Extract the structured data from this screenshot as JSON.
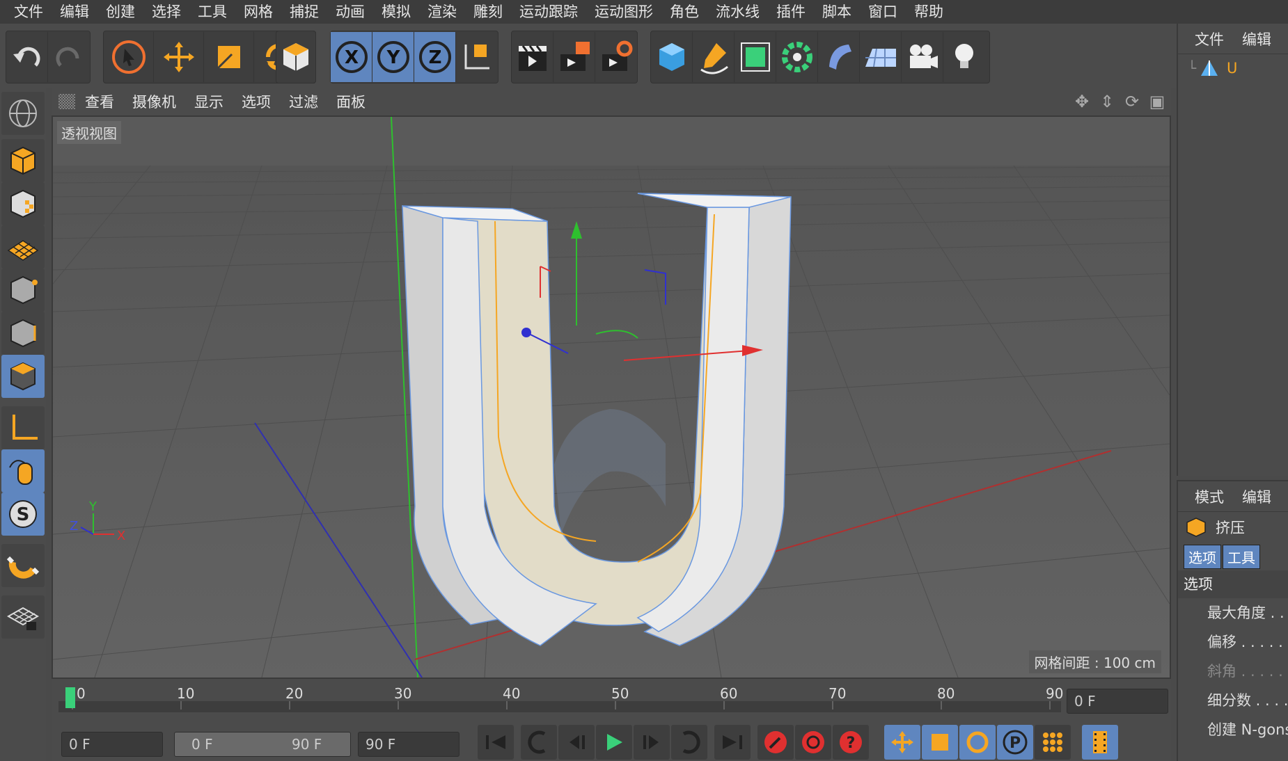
{
  "menu": [
    "文件",
    "编辑",
    "创建",
    "选择",
    "工具",
    "网格",
    "捕捉",
    "动画",
    "模拟",
    "渲染",
    "雕刻",
    "运动跟踪",
    "运动图形",
    "角色",
    "流水线",
    "插件",
    "脚本",
    "窗口",
    "帮助"
  ],
  "axes": {
    "x": "X",
    "y": "Y",
    "z": "Z"
  },
  "viewport": {
    "menu": [
      "查看",
      "摄像机",
      "显示",
      "选项",
      "过滤",
      "面板"
    ],
    "label": "透视视图",
    "grid_info": "网格间距 : 100 cm",
    "axis_y": "Y",
    "axis_z": "Z",
    "axis_x": "X"
  },
  "objects_panel": {
    "tabs": [
      "文件",
      "编辑"
    ],
    "object_name": "U"
  },
  "attributes_panel": {
    "tabs": [
      "模式",
      "编辑"
    ],
    "object_type": "挤压",
    "subtabs": [
      "选项",
      "工具"
    ],
    "section": "选项",
    "rows": [
      "最大角度 . .",
      "偏移 . . . . .",
      "斜角 . . . . .",
      "细分数 . . . .",
      "创建 N-gons"
    ]
  },
  "timeline": {
    "ticks": [
      "0",
      "10",
      "20",
      "30",
      "40",
      "50",
      "60",
      "70",
      "80",
      "90"
    ],
    "current_frame": "0 F"
  },
  "bottombar": {
    "start_field": "0 F",
    "range_start": "0 F",
    "range_end": "90 F",
    "end_field": "90 F"
  },
  "colors": {
    "accent_orange": "#f5a623",
    "active_blue": "#5f86bf",
    "axis_red": "#e03030",
    "axis_green": "#30c030",
    "axis_blue": "#3030d0"
  }
}
